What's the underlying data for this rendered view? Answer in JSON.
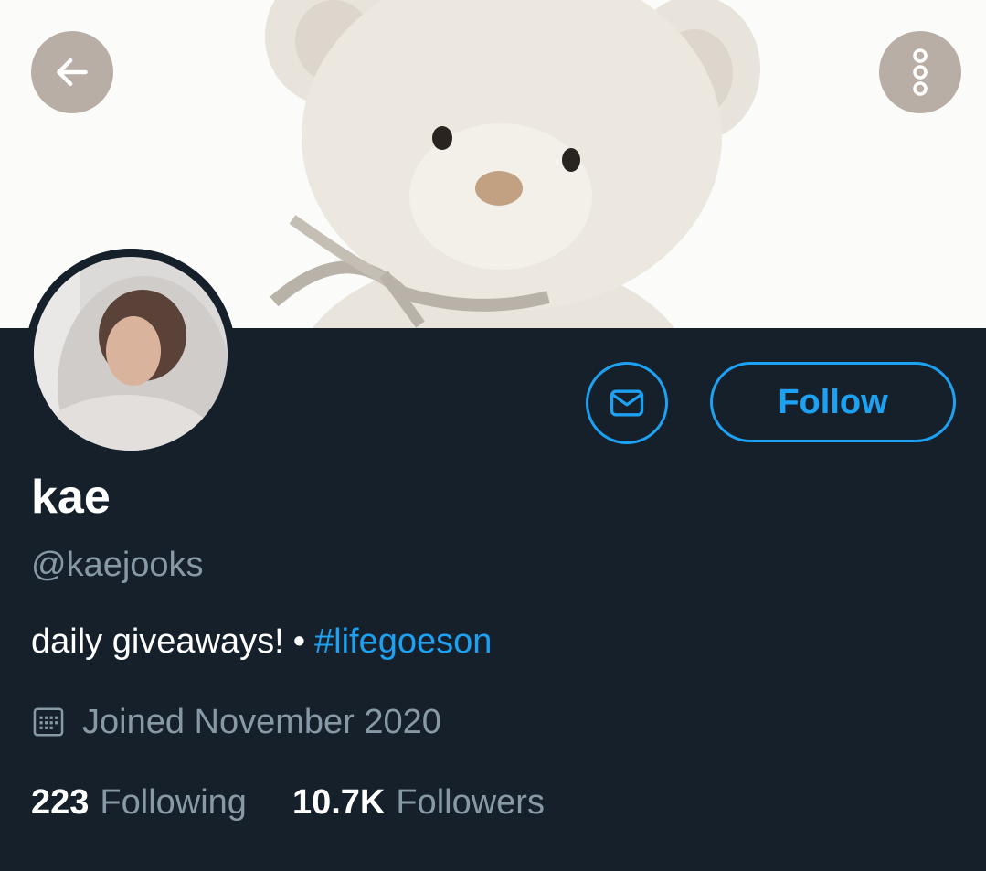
{
  "header": {
    "back_icon": "arrow-left-icon",
    "more_icon": "more-vertical-icon",
    "button_color": "#b9aea6"
  },
  "banner": {
    "subject": "teddy-bear-image"
  },
  "profile": {
    "display_name": "kae",
    "handle": "@kaejooks",
    "bio_text": "daily giveaways!",
    "bio_separator": "•",
    "bio_hashtag": "#lifegoeson",
    "joined": "Joined November 2020",
    "following_count": "223",
    "following_label": "Following",
    "followers_count": "10.7K",
    "followers_label": "Followers"
  },
  "actions": {
    "message_icon": "mail-icon",
    "follow_label": "Follow"
  },
  "colors": {
    "background": "#15202b",
    "accent": "#1da1f2",
    "secondary_text": "#8899a6",
    "primary_text": "#ffffff"
  }
}
